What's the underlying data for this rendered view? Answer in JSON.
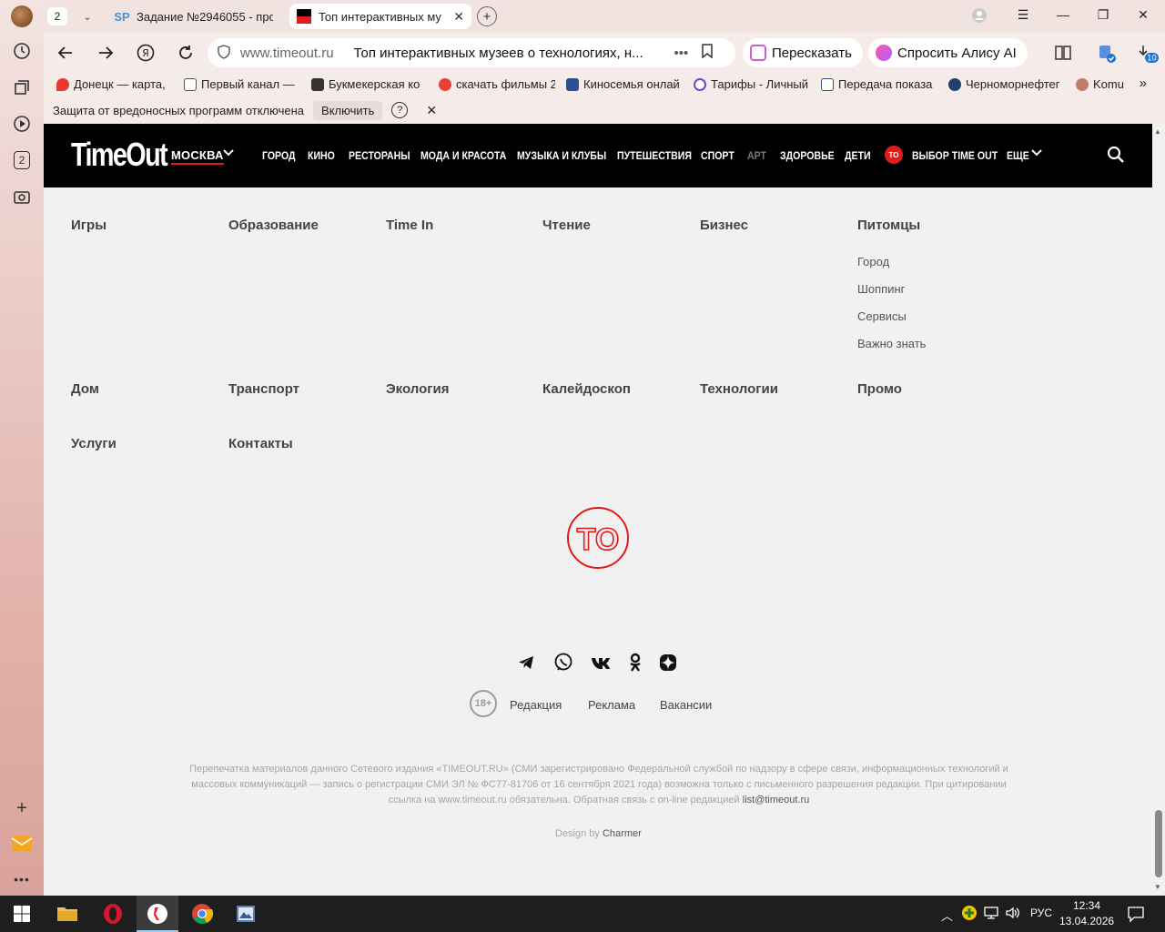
{
  "browser": {
    "tab_count": "2",
    "tabs": [
      {
        "label": "Задание №2946055 - про",
        "favicon": "SP"
      },
      {
        "label": "Топ интерактивных му",
        "active": true
      }
    ],
    "address": {
      "host": "www.timeout.ru",
      "title": "Топ интерактивных музеев о технологиях, н..."
    },
    "actions": {
      "retell": "Пересказать",
      "alice": "Спросить Алису AI"
    },
    "downloads_badge": "10",
    "bookmarks": [
      "Донецк — карта,",
      "Первый канал —",
      "Букмекерская ко",
      "скачать фильмы 2",
      "Киносемья онлай",
      "Тарифы - Личный",
      "Передача показа",
      "Черноморнефтег",
      "Komu"
    ],
    "infobar": {
      "message": "Защита от вредоносных программ отключена",
      "button": "Включить",
      "help": "?"
    },
    "sidebar_badge": "2"
  },
  "site": {
    "logo": "TimeOut",
    "city": "МОСКВА",
    "menu": [
      "ГОРОД",
      "КИНО",
      "РЕСТОРАНЫ",
      "МОДА И КРАСОТА",
      "МУЗЫКА И КЛУБЫ",
      "ПУТЕШЕСТВИЯ",
      "СПОРТ",
      "АРТ",
      "ЗДОРОВЬЕ",
      "ДЕТИ"
    ],
    "badge": "TO",
    "choice": "ВЫБОР TIME OUT",
    "more": "ЕЩЕ"
  },
  "categories": {
    "row1": [
      "Игры",
      "Образование",
      "Time In",
      "Чтение",
      "Бизнес",
      "Питомцы"
    ],
    "pets_sub": [
      "Город",
      "Шоппинг",
      "Сервисы",
      "Важно знать"
    ],
    "row2": [
      "Дом",
      "Транспорт",
      "Экология",
      "Калейдоскоп",
      "Технологии",
      "Промо"
    ],
    "row3": [
      "Услуги",
      "Контакты"
    ]
  },
  "footer": {
    "big_logo": "TO",
    "socials": [
      "telegram-icon",
      "viber-icon",
      "vk-icon",
      "odnoklassniki-icon",
      "dzen-icon"
    ],
    "age": "18+",
    "links": [
      "Редакция",
      "Реклама",
      "Вакансии"
    ],
    "legal": "Перепечатка материалов данного Сетевого издания «TIMEOUT.RU» (СМИ зарегистрировано Федеральной службой по надзору в сфере связи, информационных технологий и массовых коммуникаций — запись о регистрации СМИ ЭЛ № ФС77-81706 от 16 сентября 2021 года) возможна только с письменного разрешения редакции. При цитировании ссылка на www.timeout.ru обязательна. Обратная связь с on-line редакцией",
    "email": "list@timeout.ru",
    "design_prefix": "Design by",
    "design_by": "Charmer"
  },
  "taskbar": {
    "lang": "РУС",
    "time": "12:34",
    "date": "13.04.2026"
  },
  "colors": {
    "accent": "#e31a1a",
    "header_bg": "#000000",
    "page_bg": "#f1f1f1"
  }
}
